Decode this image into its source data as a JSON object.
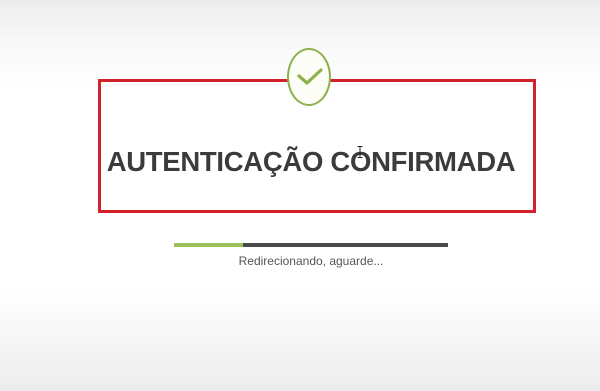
{
  "headline": "AUTENTICAÇÃO CONFIRMADA",
  "status_text": "Redirecionando, aguarde...",
  "progress": {
    "fraction": 0.25,
    "fill_color": "#9bc25d",
    "track_color": "#4a4a4a"
  },
  "icons": {
    "status": "check-circle-icon",
    "cursor": "text-cursor-icon"
  },
  "colors": {
    "check_accent": "#8db04b",
    "highlight_frame": "#d3222c",
    "headline_text": "#3b3b3b"
  }
}
